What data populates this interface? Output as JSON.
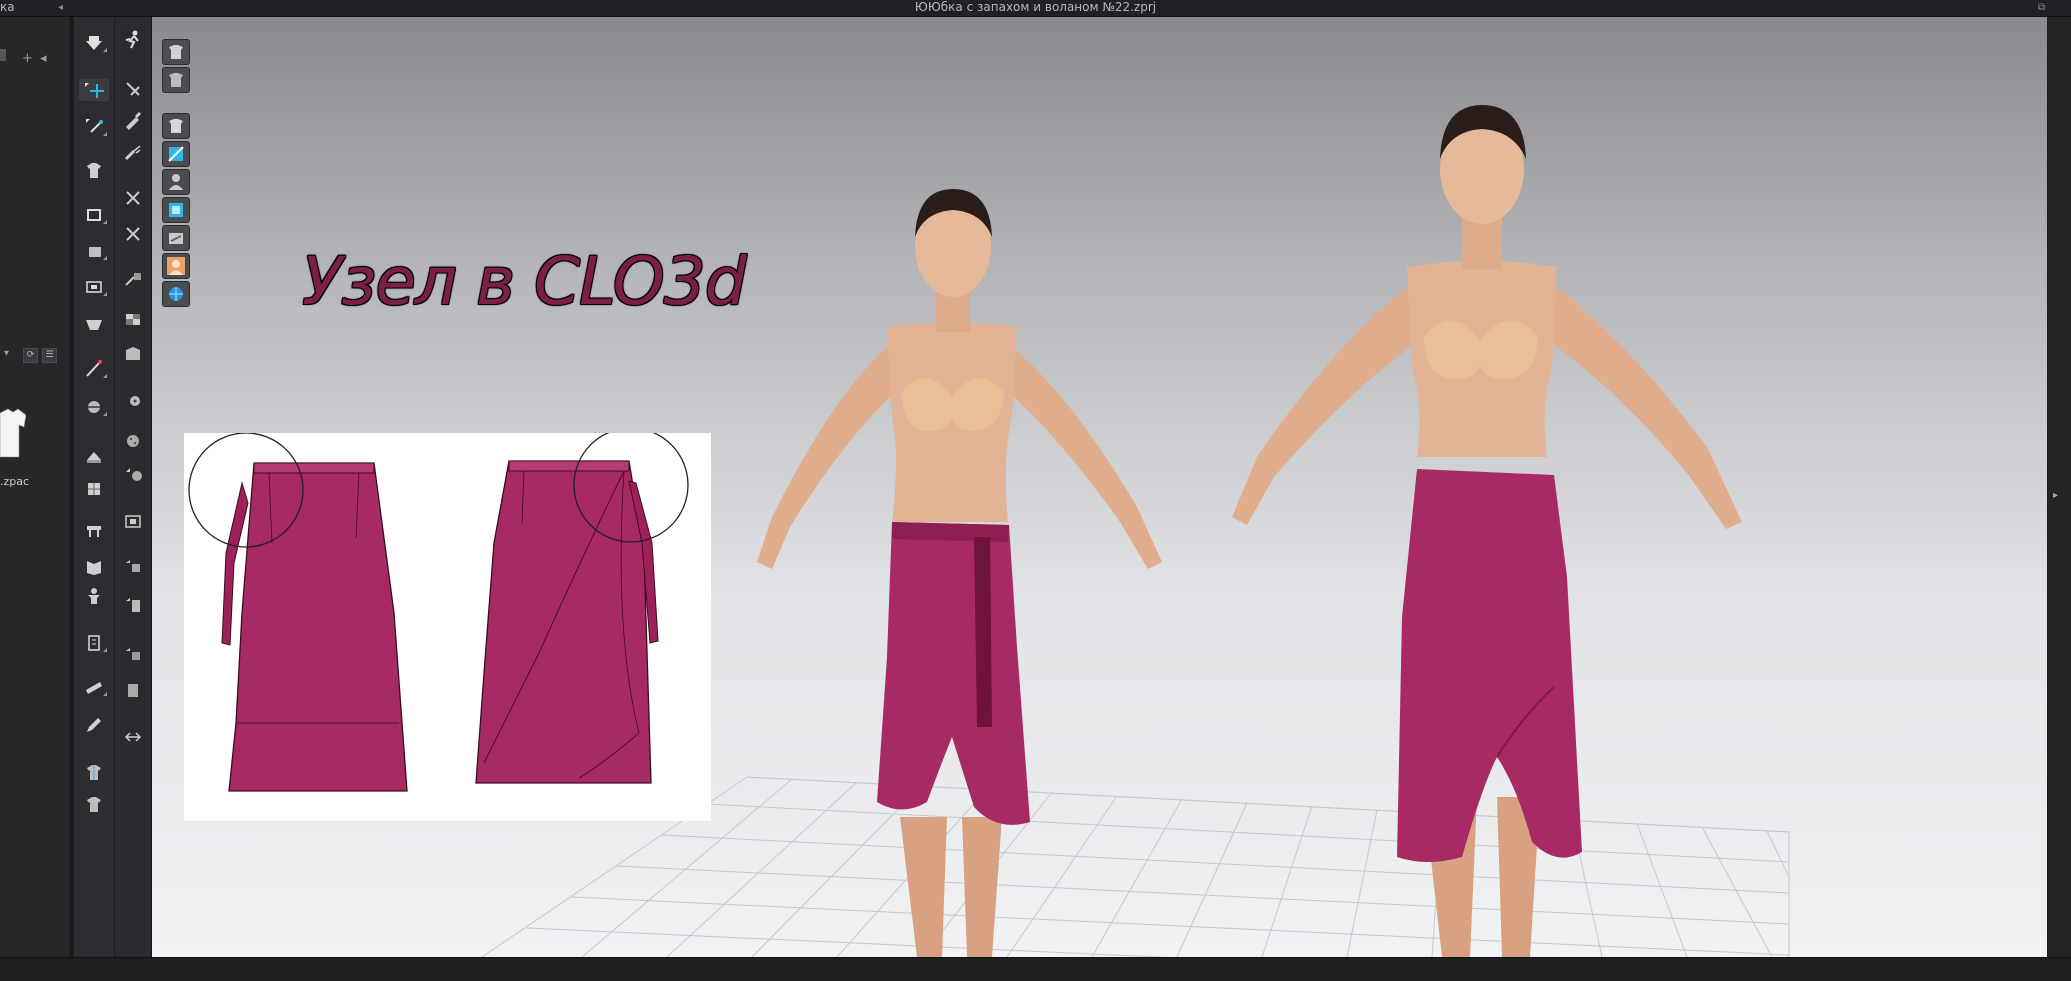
{
  "window": {
    "title": "ЮЮбка с запахом и воланом №22.zprj",
    "library_tab_label": "ка",
    "collapse_icon": "◂",
    "window_icon": "⧉"
  },
  "library": {
    "add_icon": "+",
    "back_icon": "◂",
    "refresh_icon": "⟳",
    "list_icon": "☰",
    "dropdown_icon": "▾",
    "thumbnail_label": ".zpac"
  },
  "canvas": {
    "overlay_title": "Узел в CLO3d"
  },
  "colors": {
    "fabric": "#a82a64",
    "fabric_dark": "#7d1a48",
    "skin": "#e2b394",
    "tool_accent": "#2fb4e8",
    "panel_bg": "#262729"
  },
  "right_panel": {
    "expand_icon": "▸"
  }
}
